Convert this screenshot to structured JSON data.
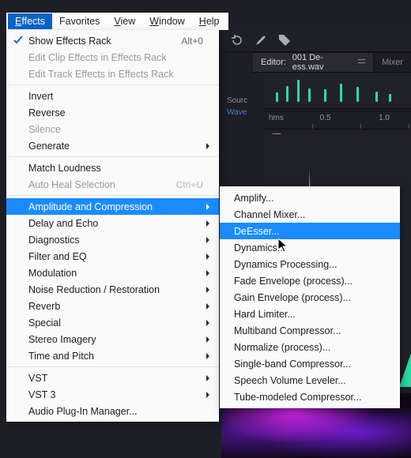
{
  "menubar": {
    "items": [
      {
        "underline": "E",
        "rest": "ffects"
      },
      {
        "underline": "",
        "rest": "Favorites"
      },
      {
        "underline": "V",
        "rest": "iew"
      },
      {
        "underline": "W",
        "rest": "indow"
      },
      {
        "underline": "H",
        "rest": "elp"
      }
    ],
    "active_index": 0
  },
  "editor": {
    "tab_prefix": "Editor:",
    "filename": "001 De-ess.wav",
    "mixer_label": "Mixer",
    "labels": {
      "source": "Sourc",
      "wave": "Wave"
    },
    "ruler": {
      "t0": "hms",
      "t05": "0.5",
      "t10": "1.0"
    }
  },
  "menu": {
    "items": [
      {
        "label": "Show Effects Rack",
        "shortcut": "Alt+0",
        "checked": true
      },
      {
        "label": "Edit Clip Effects in Effects Rack",
        "disabled": true
      },
      {
        "label": "Edit Track Effects in Effects Rack",
        "disabled": true
      },
      {
        "sep": true
      },
      {
        "label": "Invert"
      },
      {
        "label": "Reverse"
      },
      {
        "label": "Silence",
        "disabled": true
      },
      {
        "label": "Generate",
        "submenu": true
      },
      {
        "sep": true
      },
      {
        "label": "Match Loudness"
      },
      {
        "label": "Auto Heal Selection",
        "shortcut": "Ctrl+U",
        "disabled": true
      },
      {
        "sep": true
      },
      {
        "label": "Amplitude and Compression",
        "submenu": true,
        "hover": true
      },
      {
        "label": "Delay and Echo",
        "submenu": true
      },
      {
        "label": "Diagnostics",
        "submenu": true
      },
      {
        "label": "Filter and EQ",
        "submenu": true
      },
      {
        "label": "Modulation",
        "submenu": true
      },
      {
        "label": "Noise Reduction / Restoration",
        "submenu": true
      },
      {
        "label": "Reverb",
        "submenu": true
      },
      {
        "label": "Special",
        "submenu": true
      },
      {
        "label": "Stereo Imagery",
        "submenu": true
      },
      {
        "label": "Time and Pitch",
        "submenu": true
      },
      {
        "sep": true
      },
      {
        "label": "VST",
        "submenu": true
      },
      {
        "label": "VST 3",
        "submenu": true
      },
      {
        "label": "Audio Plug-In Manager..."
      }
    ]
  },
  "submenu": {
    "items": [
      {
        "label": "Amplify..."
      },
      {
        "label": "Channel Mixer..."
      },
      {
        "label": "DeEsser...",
        "hover": true
      },
      {
        "label": "Dynamics..."
      },
      {
        "label": "Dynamics Processing..."
      },
      {
        "label": "Fade Envelope (process)..."
      },
      {
        "label": "Gain Envelope (process)..."
      },
      {
        "label": "Hard Limiter..."
      },
      {
        "label": "Multiband Compressor..."
      },
      {
        "label": "Normalize (process)..."
      },
      {
        "label": "Single-band Compressor..."
      },
      {
        "label": "Speech Volume Leveler..."
      },
      {
        "label": "Tube-modeled Compressor..."
      }
    ]
  }
}
